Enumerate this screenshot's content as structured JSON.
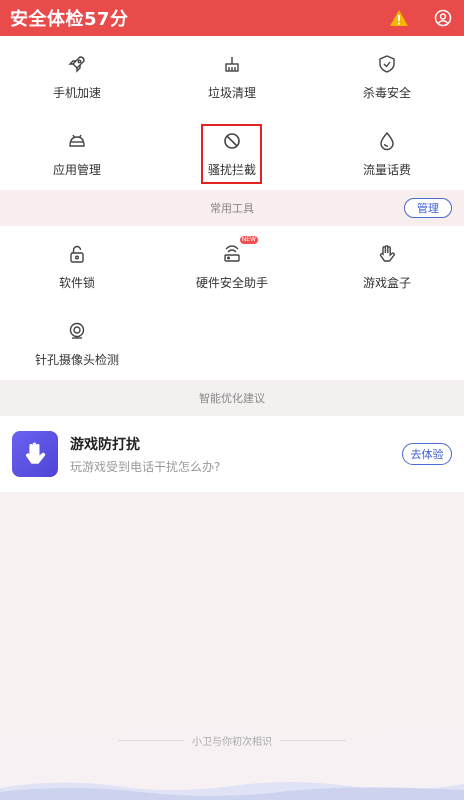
{
  "header": {
    "title": "安全体检57分",
    "warning_icon": "warning-icon",
    "user_icon": "user-icon"
  },
  "grid1": [
    {
      "label": "手机加速",
      "icon": "rocket-icon"
    },
    {
      "label": "垃圾清理",
      "icon": "broom-icon"
    },
    {
      "label": "杀毒安全",
      "icon": "shield-icon"
    },
    {
      "label": "应用管理",
      "icon": "android-icon"
    },
    {
      "label": "骚扰拦截",
      "icon": "block-icon"
    },
    {
      "label": "流量话费",
      "icon": "drop-icon"
    }
  ],
  "tools_section": {
    "title": "常用工具",
    "manage_label": "管理"
  },
  "grid2": [
    {
      "label": "软件锁",
      "icon": "lock-icon"
    },
    {
      "label": "硬件安全助手",
      "icon": "router-icon",
      "badge": "NEW"
    },
    {
      "label": "游戏盒子",
      "icon": "hand-icon"
    },
    {
      "label": "针孔摄像头检测",
      "icon": "camera-icon"
    }
  ],
  "suggest_section": {
    "title": "智能优化建议"
  },
  "suggestion_card": {
    "title": "游戏防打扰",
    "subtitle": "玩游戏受到电话干扰怎么办?",
    "button": "去体验"
  },
  "footer": {
    "text": "小卫与你初次相识"
  },
  "colors": {
    "header": "#e94b4b",
    "accent": "#3f5fd4",
    "highlight": "#e02424"
  }
}
